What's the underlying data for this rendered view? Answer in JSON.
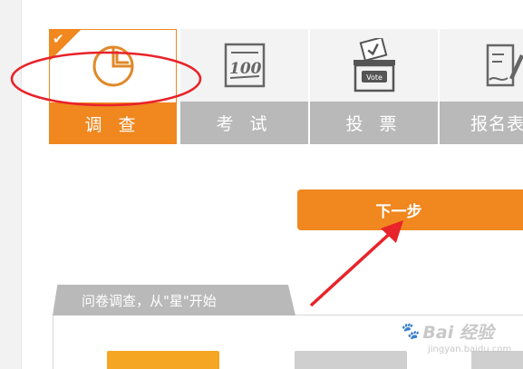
{
  "types": [
    {
      "id": "survey",
      "label": "调 查",
      "icon": "pie-chart-icon",
      "active": true
    },
    {
      "id": "exam",
      "label": "考 试",
      "icon": "exam-paper-icon",
      "active": false
    },
    {
      "id": "vote",
      "label": "投 票",
      "icon": "ballot-box-icon",
      "active": false,
      "icon_text": "Vote"
    },
    {
      "id": "signup",
      "label": "报名表单",
      "icon": "signup-form-icon",
      "active": false
    }
  ],
  "next_button": {
    "label": "下一步"
  },
  "section": {
    "tab_label": "问卷调查，从\"星\"开始"
  },
  "watermark": {
    "main": "Bai 经验",
    "sub": "jingyan.baidu.com"
  },
  "colors": {
    "accent": "#f0871f",
    "inactive": "#b9b9b9",
    "annotation": "#e8232a"
  }
}
